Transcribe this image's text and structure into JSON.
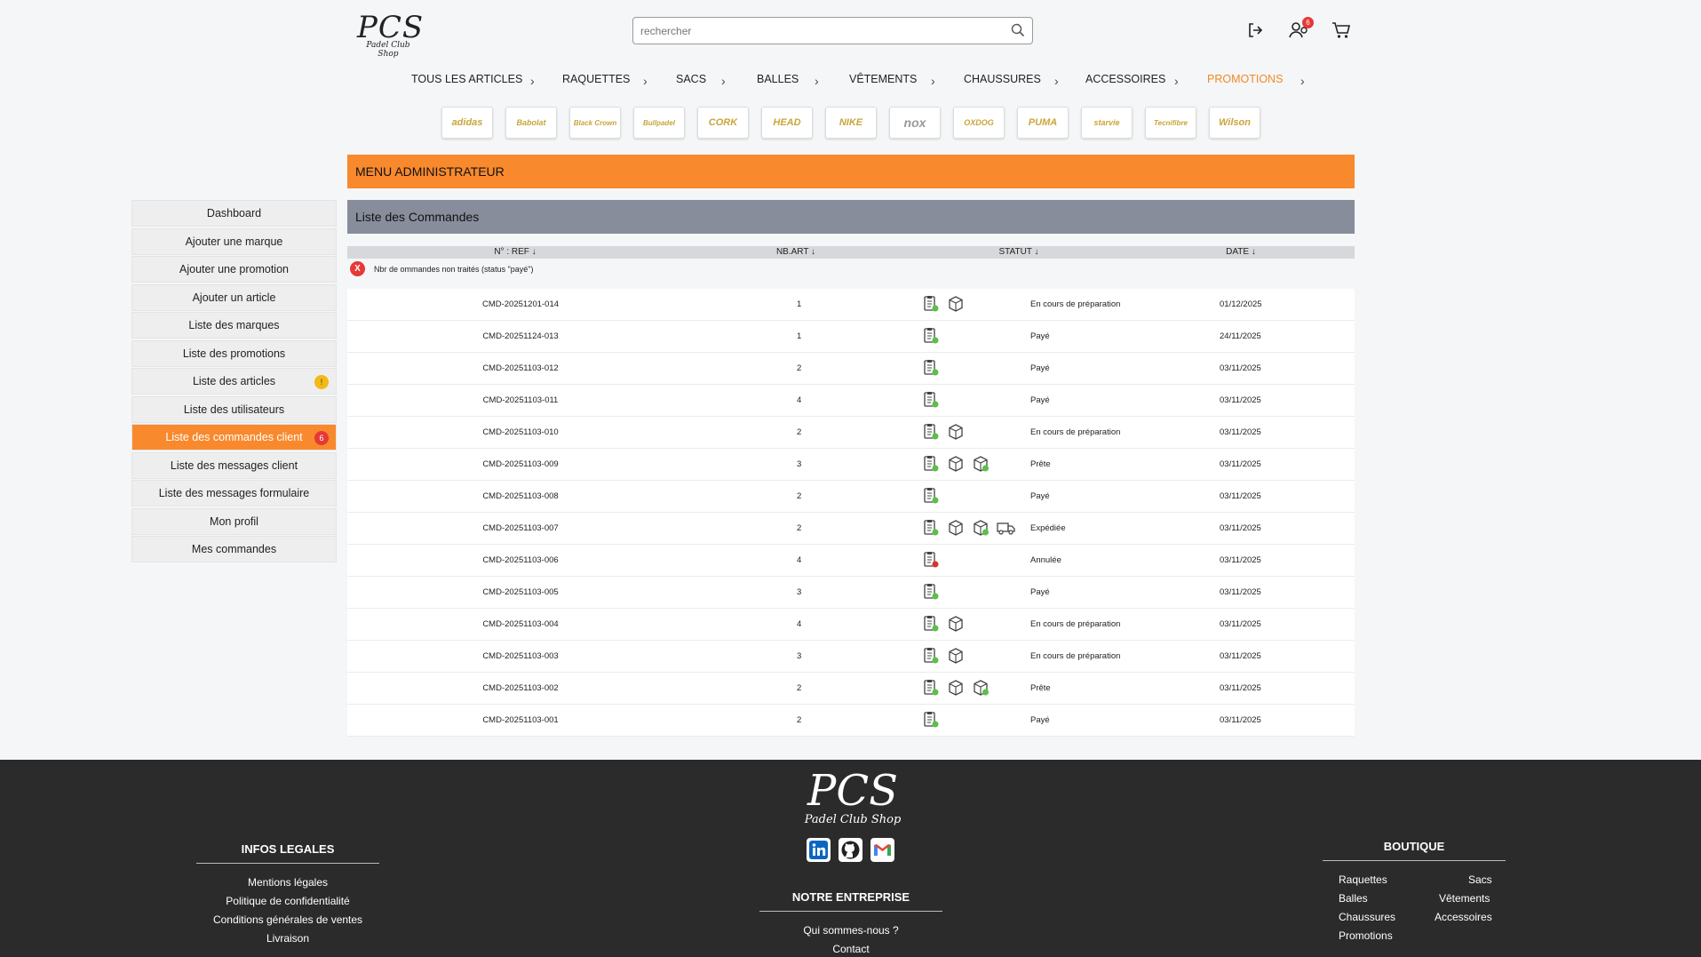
{
  "logo": {
    "title": "PCS",
    "subtitle": "Padel Club Shop"
  },
  "search": {
    "placeholder": "rechercher"
  },
  "header": {
    "notification_count": "6"
  },
  "nav": {
    "items": [
      "TOUS LES ARTICLES",
      "RAQUETTES",
      "SACS",
      "BALLES",
      "VÊTEMENTS",
      "CHAUSSURES",
      "ACCESSOIRES",
      "PROMOTIONS"
    ],
    "active_color": "#f08a24"
  },
  "brands": [
    "adidas",
    "Babolat",
    "Black Crown",
    "Bullpadel",
    "CORK",
    "HEAD",
    "NIKE",
    "nox",
    "OXDOG",
    "PUMA",
    "starvie",
    "Tecnifibre",
    "Wilson"
  ],
  "sidebar": {
    "items": [
      {
        "label": "Dashboard"
      },
      {
        "label": "Ajouter une marque"
      },
      {
        "label": "Ajouter une promotion"
      },
      {
        "label": "Ajouter un article"
      },
      {
        "label": "Liste des marques"
      },
      {
        "label": "Liste des promotions"
      },
      {
        "label": "Liste des articles",
        "badge": "!"
      },
      {
        "label": "Liste des utilisateurs"
      },
      {
        "label": "Liste des commandes client",
        "badge": "6"
      },
      {
        "label": "Liste des messages client"
      },
      {
        "label": "Liste des messages formulaire"
      },
      {
        "label": "Mon profil"
      },
      {
        "label": "Mes commandes"
      }
    ]
  },
  "admin": {
    "title": "MENU ADMINISTRATEUR",
    "accent": "#f8892d"
  },
  "orders": {
    "title": "Liste des Commandes",
    "columns": {
      "ref": "N° : REF ↓",
      "nb": "NB.ART ↓",
      "status": "STATUT ↓",
      "date": "DATE ↓"
    },
    "legend_mark": "X",
    "legend": "Nbr de ommandes non traités (status \"payé\")",
    "rows": [
      {
        "ref": "CMD-20251201-014",
        "nb": "1",
        "status": "En cours de préparation",
        "date": "01/12/2025",
        "icons": [
          "paid",
          "box"
        ]
      },
      {
        "ref": "CMD-20251124-013",
        "nb": "1",
        "status": "Payé",
        "date": "24/11/2025",
        "icons": [
          "paid"
        ]
      },
      {
        "ref": "CMD-20251103-012",
        "nb": "2",
        "status": "Payé",
        "date": "03/11/2025",
        "icons": [
          "paid"
        ]
      },
      {
        "ref": "CMD-20251103-011",
        "nb": "4",
        "status": "Payé",
        "date": "03/11/2025",
        "icons": [
          "paid"
        ]
      },
      {
        "ref": "CMD-20251103-010",
        "nb": "2",
        "status": "En cours de préparation",
        "date": "03/11/2025",
        "icons": [
          "paid",
          "box"
        ]
      },
      {
        "ref": "CMD-20251103-009",
        "nb": "3",
        "status": "Prête",
        "date": "03/11/2025",
        "icons": [
          "paid",
          "box",
          "ready"
        ]
      },
      {
        "ref": "CMD-20251103-008",
        "nb": "2",
        "status": "Payé",
        "date": "03/11/2025",
        "icons": [
          "paid"
        ]
      },
      {
        "ref": "CMD-20251103-007",
        "nb": "2",
        "status": "Expédiée",
        "date": "03/11/2025",
        "icons": [
          "paid",
          "box",
          "ready",
          "truck"
        ]
      },
      {
        "ref": "CMD-20251103-006",
        "nb": "4",
        "status": "Annulée",
        "date": "03/11/2025",
        "icons": [
          "cancel"
        ]
      },
      {
        "ref": "CMD-20251103-005",
        "nb": "3",
        "status": "Payé",
        "date": "03/11/2025",
        "icons": [
          "paid"
        ]
      },
      {
        "ref": "CMD-20251103-004",
        "nb": "4",
        "status": "En cours de préparation",
        "date": "03/11/2025",
        "icons": [
          "paid",
          "box"
        ]
      },
      {
        "ref": "CMD-20251103-003",
        "nb": "3",
        "status": "En cours de préparation",
        "date": "03/11/2025",
        "icons": [
          "paid",
          "box"
        ]
      },
      {
        "ref": "CMD-20251103-002",
        "nb": "2",
        "status": "Prête",
        "date": "03/11/2025",
        "icons": [
          "paid",
          "box",
          "ready"
        ]
      },
      {
        "ref": "CMD-20251103-001",
        "nb": "2",
        "status": "Payé",
        "date": "03/11/2025",
        "icons": [
          "paid"
        ]
      }
    ]
  },
  "footer": {
    "logo_title": "PCS",
    "logo_subtitle": "Padel Club Shop",
    "legal": {
      "title": "INFOS LEGALES",
      "links": [
        "Mentions légales",
        "Politique de confidentialité",
        "Conditions générales de ventes",
        "Livraison"
      ]
    },
    "company": {
      "title": "NOTRE ENTREPRISE",
      "links": [
        "Qui sommes-nous ?",
        "Contact"
      ]
    },
    "shop": {
      "title": "BOUTIQUE",
      "left": [
        "Raquettes",
        "Balles",
        "Chaussures",
        "Promotions"
      ],
      "right": [
        "Sacs",
        "Vêtements",
        "Accessoires"
      ]
    }
  }
}
